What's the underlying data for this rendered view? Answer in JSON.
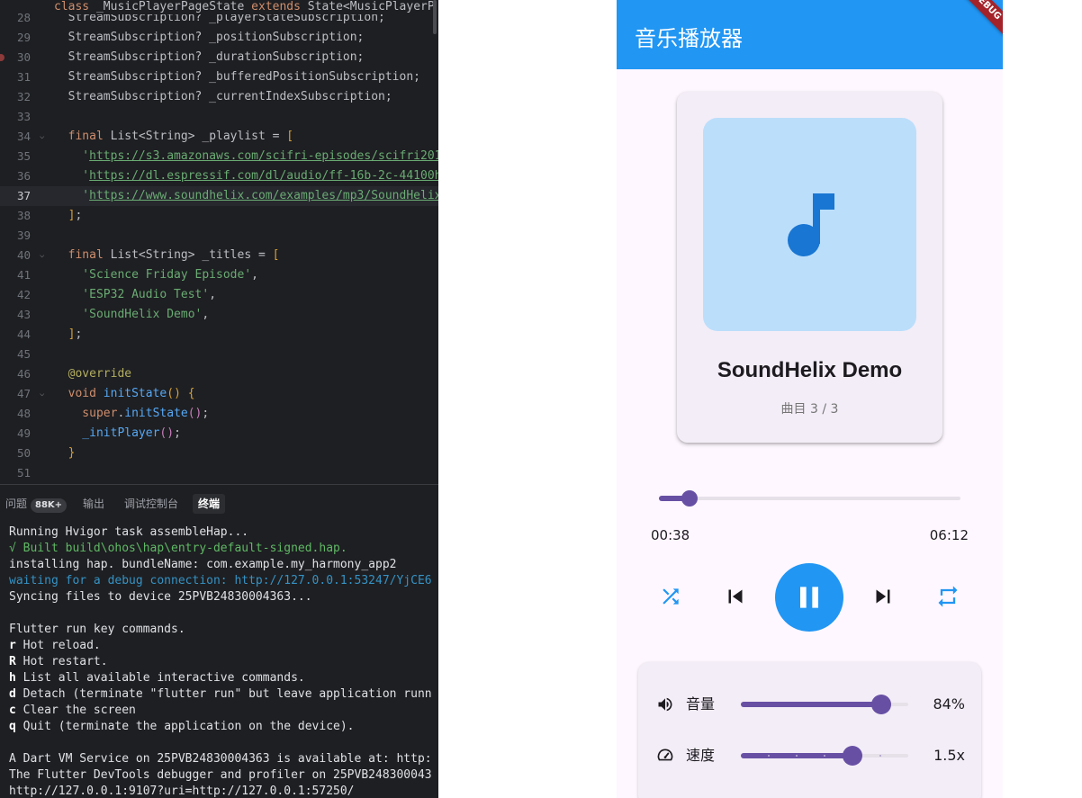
{
  "ide": {
    "class_header": {
      "kw1": "class",
      "name": "_MusicPlayerPageState",
      "kw2": "extends",
      "rest": "State<MusicPlayerP"
    },
    "lines": [
      {
        "n": "28",
        "parts": [
          {
            "c": "ty",
            "t": "  StreamSubscription? _playerStateSubscription;"
          }
        ]
      },
      {
        "n": "29",
        "parts": [
          {
            "c": "ty",
            "t": "  StreamSubscription? _positionSubscription;"
          }
        ]
      },
      {
        "n": "30",
        "bp": true,
        "parts": [
          {
            "c": "ty",
            "t": "  StreamSubscription? _durationSubscription;"
          }
        ]
      },
      {
        "n": "31",
        "parts": [
          {
            "c": "ty",
            "t": "  StreamSubscription? _bufferedPositionSubscription;"
          }
        ]
      },
      {
        "n": "32",
        "parts": [
          {
            "c": "ty",
            "t": "  StreamSubscription? _currentIndexSubscription;"
          }
        ]
      },
      {
        "n": "33",
        "parts": []
      },
      {
        "n": "34",
        "fold": true,
        "parts": [
          {
            "c": "kw",
            "t": "  final "
          },
          {
            "c": "ty",
            "t": "List<String> _playlist = "
          },
          {
            "c": "br1",
            "t": "["
          }
        ]
      },
      {
        "n": "35",
        "parts": [
          {
            "c": "str",
            "t": "    '"
          },
          {
            "c": "url",
            "t": "https://s3.amazonaws.com/scifri-episodes/scifri201"
          }
        ]
      },
      {
        "n": "36",
        "parts": [
          {
            "c": "str",
            "t": "    '"
          },
          {
            "c": "url",
            "t": "https://dl.espressif.com/dl/audio/ff-16b-2c-44100h"
          }
        ]
      },
      {
        "n": "37",
        "current": true,
        "parts": [
          {
            "c": "str",
            "t": "    '"
          },
          {
            "c": "url",
            "t": "https://www.soundhelix.com/examples/mp3/SoundHelix"
          }
        ]
      },
      {
        "n": "38",
        "parts": [
          {
            "c": "br1",
            "t": "  ]"
          },
          {
            "c": "ty",
            "t": ";"
          }
        ]
      },
      {
        "n": "39",
        "parts": []
      },
      {
        "n": "40",
        "fold": true,
        "parts": [
          {
            "c": "kw",
            "t": "  final "
          },
          {
            "c": "ty",
            "t": "List<String> _titles = "
          },
          {
            "c": "br1",
            "t": "["
          }
        ]
      },
      {
        "n": "41",
        "parts": [
          {
            "c": "str",
            "t": "    'Science Friday Episode'"
          },
          {
            "c": "ty",
            "t": ","
          }
        ]
      },
      {
        "n": "42",
        "parts": [
          {
            "c": "str",
            "t": "    'ESP32 Audio Test'"
          },
          {
            "c": "ty",
            "t": ","
          }
        ]
      },
      {
        "n": "43",
        "parts": [
          {
            "c": "str",
            "t": "    'SoundHelix Demo'"
          },
          {
            "c": "ty",
            "t": ","
          }
        ]
      },
      {
        "n": "44",
        "parts": [
          {
            "c": "br1",
            "t": "  ]"
          },
          {
            "c": "ty",
            "t": ";"
          }
        ]
      },
      {
        "n": "45",
        "parts": []
      },
      {
        "n": "46",
        "parts": [
          {
            "c": "ann",
            "t": "  @override"
          }
        ]
      },
      {
        "n": "47",
        "fold": true,
        "parts": [
          {
            "c": "kw",
            "t": "  void "
          },
          {
            "c": "fn",
            "t": "initState"
          },
          {
            "c": "br1",
            "t": "()"
          },
          {
            "c": "ty",
            "t": " "
          },
          {
            "c": "br1",
            "t": "{"
          }
        ]
      },
      {
        "n": "48",
        "parts": [
          {
            "c": "kw",
            "t": "    super"
          },
          {
            "c": "ty",
            "t": "."
          },
          {
            "c": "fn",
            "t": "initState"
          },
          {
            "c": "br2",
            "t": "()"
          },
          {
            "c": "ty",
            "t": ";"
          }
        ]
      },
      {
        "n": "49",
        "parts": [
          {
            "c": "fn",
            "t": "    _initPlayer"
          },
          {
            "c": "br2",
            "t": "()"
          },
          {
            "c": "ty",
            "t": ";"
          }
        ]
      },
      {
        "n": "50",
        "parts": [
          {
            "c": "br1",
            "t": "  }"
          }
        ]
      },
      {
        "n": "51",
        "parts": []
      }
    ],
    "panel": {
      "tabs": [
        {
          "label": "问题",
          "badge": "88K+"
        },
        {
          "label": "输出"
        },
        {
          "label": "调试控制台"
        },
        {
          "label": "终端",
          "active": true
        }
      ],
      "terminal": [
        {
          "t": "Running Hvigor task assembleHap..."
        },
        {
          "t": "√ Built build\\ohos\\hap\\entry-default-signed.hap.",
          "c": "green"
        },
        {
          "t": "installing hap. bundleName: com.example.my_harmony_app2"
        },
        {
          "t": "waiting for a debug connection: http://127.0.0.1:53247/YjCE6",
          "c": "blue"
        },
        {
          "t": "Syncing files to device 25PVB24830004363..."
        },
        {
          "t": ""
        },
        {
          "t": "Flutter run key commands."
        },
        {
          "k": "r",
          "t": " Hot reload."
        },
        {
          "k": "R",
          "t": " Hot restart."
        },
        {
          "k": "h",
          "t": " List all available interactive commands."
        },
        {
          "k": "d",
          "t": " Detach (terminate \"flutter run\" but leave application runn"
        },
        {
          "k": "c",
          "t": " Clear the screen"
        },
        {
          "k": "q",
          "t": " Quit (terminate the application on the device)."
        },
        {
          "t": ""
        },
        {
          "t": "A Dart VM Service on 25PVB24830004363 is available at: http:"
        },
        {
          "t": "The Flutter DevTools debugger and profiler on 25PVB248300043"
        },
        {
          "t": "http://127.0.0.1:9107?uri=http://127.0.0.1:57250/"
        }
      ]
    }
  },
  "app": {
    "title": "音乐播放器",
    "debug_banner": "DEBUG",
    "song": {
      "title": "SoundHelix Demo",
      "track_info": "曲目 3 / 3",
      "artwork_icon": "music-note-icon"
    },
    "progress": {
      "position": "00:38",
      "duration": "06:12",
      "fraction": 0.102
    },
    "controls": {
      "shuffle_icon": "shuffle-icon",
      "prev_icon": "skip-previous-icon",
      "play_icon": "pause-icon",
      "next_icon": "skip-next-icon",
      "repeat_icon": "repeat-icon"
    },
    "volume": {
      "label": "音量",
      "value_text": "84%",
      "fraction": 0.84,
      "icon": "volume-icon"
    },
    "speed": {
      "label": "速度",
      "value_text": "1.5x",
      "fraction": 0.667,
      "divisions": 6,
      "icon": "speedometer-icon"
    },
    "colors": {
      "appbar": "#2196f3",
      "accent": "#6750a4",
      "artwork_bg": "#bbdefb",
      "icon_blue": "#1976d2"
    }
  }
}
